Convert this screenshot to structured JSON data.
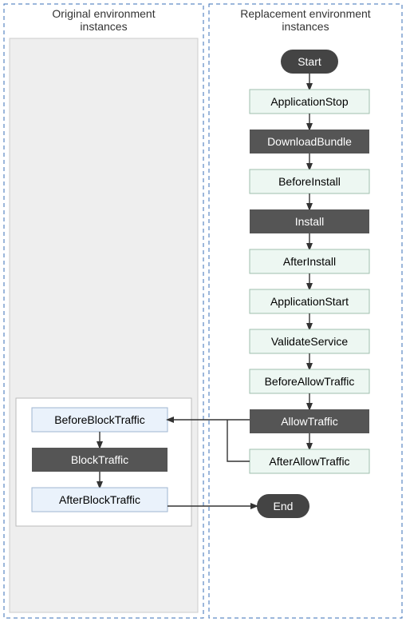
{
  "headers": {
    "left_line1": "Original environment",
    "left_line2": "instances",
    "right_line1": "Replacement environment",
    "right_line2": "instances"
  },
  "nodes": {
    "start": "Start",
    "end": "End",
    "appStop": "ApplicationStop",
    "downloadBundle": "DownloadBundle",
    "beforeInstall": "BeforeInstall",
    "install": "Install",
    "afterInstall": "AfterInstall",
    "appStart": "ApplicationStart",
    "validateService": "ValidateService",
    "beforeAllowTraffic": "BeforeAllowTraffic",
    "allowTraffic": "AllowTraffic",
    "afterAllowTraffic": "AfterAllowTraffic",
    "beforeBlockTraffic": "BeforeBlockTraffic",
    "blockTraffic": "BlockTraffic",
    "afterBlockTraffic": "AfterBlockTraffic"
  },
  "colors": {
    "lightBox": "#edf7f2",
    "lightBoxStroke": "#9fbfae",
    "darkBox": "#555555",
    "darkBoxText": "#ffffff",
    "terminal": "#444444",
    "arrow": "#333333",
    "dashed": "#3a6fb7",
    "leftPanelFill": "#eeeeee",
    "leftPanelStroke": "#cccccc",
    "leftBox": "#eaf2fb",
    "leftBoxStroke": "#9fb6d1",
    "innerGroupStroke": "#bbbbbb"
  },
  "diagram_data": {
    "type": "flowchart",
    "title": "Deployment lifecycle events — original vs replacement environment instances",
    "groups": [
      {
        "id": "original",
        "label": "Original environment instances"
      },
      {
        "id": "replacement",
        "label": "Replacement environment instances"
      }
    ],
    "flow_replacement": [
      "Start",
      "ApplicationStop",
      "DownloadBundle",
      "BeforeInstall",
      "Install",
      "AfterInstall",
      "ApplicationStart",
      "ValidateService",
      "BeforeAllowTraffic",
      "AllowTraffic",
      "AfterAllowTraffic"
    ],
    "flow_original": [
      "BeforeBlockTraffic",
      "BlockTraffic",
      "AfterBlockTraffic"
    ],
    "cross_edges": [
      {
        "from": "AllowTraffic",
        "to": "BeforeBlockTraffic"
      },
      {
        "from": "AfterAllowTraffic",
        "to": "BeforeBlockTraffic"
      },
      {
        "from": "AfterBlockTraffic",
        "to": "End"
      }
    ],
    "node_styles": {
      "dark": [
        "DownloadBundle",
        "Install",
        "AllowTraffic",
        "BlockTraffic"
      ],
      "terminal": [
        "Start",
        "End"
      ]
    }
  }
}
